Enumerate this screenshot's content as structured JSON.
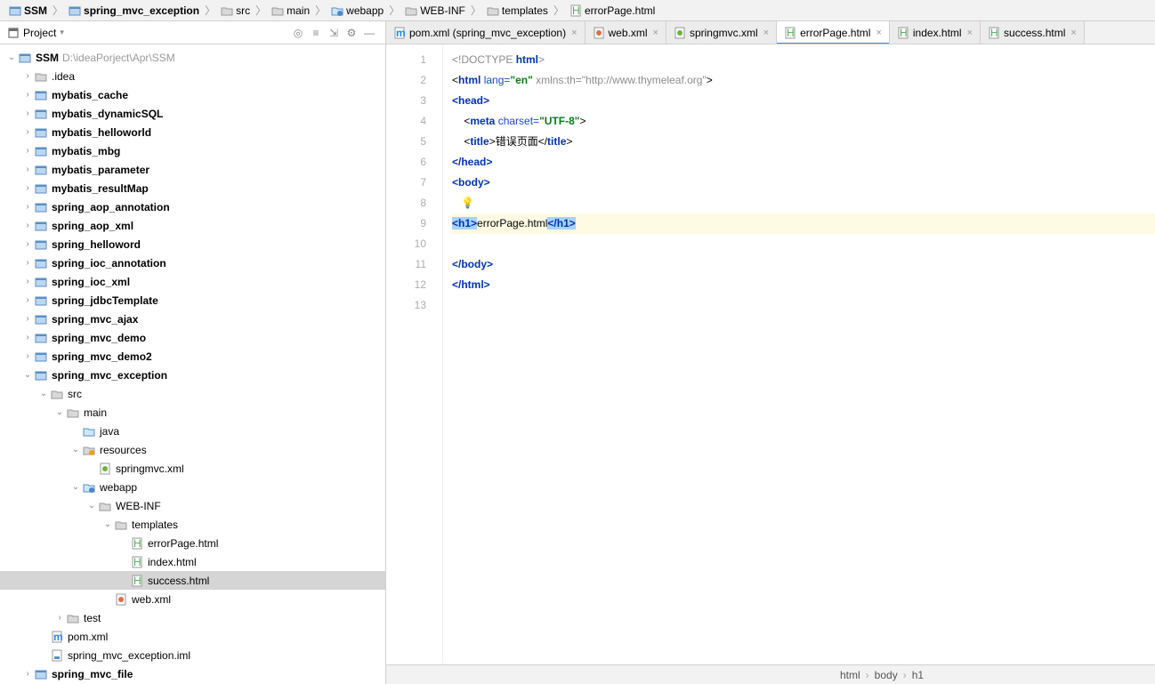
{
  "breadcrumb": [
    {
      "icon": "module",
      "label": "SSM",
      "bold": true
    },
    {
      "icon": "module",
      "label": "spring_mvc_exception",
      "bold": true
    },
    {
      "icon": "folder",
      "label": "src"
    },
    {
      "icon": "folder",
      "label": "main"
    },
    {
      "icon": "folder-web",
      "label": "webapp"
    },
    {
      "icon": "folder",
      "label": "WEB-INF"
    },
    {
      "icon": "folder",
      "label": "templates"
    },
    {
      "icon": "html",
      "label": "errorPage.html"
    }
  ],
  "sidebar": {
    "title": "Project",
    "tools": [
      "target-icon",
      "expand-icon",
      "collapse-icon",
      "gear-icon",
      "hide-icon"
    ]
  },
  "tree": [
    {
      "depth": 0,
      "arrow": "down",
      "icon": "module",
      "label": "SSM",
      "bold": true,
      "extra": "D:\\ideaPorject\\Apr\\SSM"
    },
    {
      "depth": 1,
      "arrow": "right",
      "icon": "folder",
      "label": ".idea"
    },
    {
      "depth": 1,
      "arrow": "right",
      "icon": "module",
      "label": "mybatis_cache",
      "bold": true
    },
    {
      "depth": 1,
      "arrow": "right",
      "icon": "module",
      "label": "mybatis_dynamicSQL",
      "bold": true
    },
    {
      "depth": 1,
      "arrow": "right",
      "icon": "module",
      "label": "mybatis_helloworld",
      "bold": true
    },
    {
      "depth": 1,
      "arrow": "right",
      "icon": "module",
      "label": "mybatis_mbg",
      "bold": true
    },
    {
      "depth": 1,
      "arrow": "right",
      "icon": "module",
      "label": "mybatis_parameter",
      "bold": true
    },
    {
      "depth": 1,
      "arrow": "right",
      "icon": "module",
      "label": "mybatis_resultMap",
      "bold": true
    },
    {
      "depth": 1,
      "arrow": "right",
      "icon": "module",
      "label": "spring_aop_annotation",
      "bold": true
    },
    {
      "depth": 1,
      "arrow": "right",
      "icon": "module",
      "label": "spring_aop_xml",
      "bold": true
    },
    {
      "depth": 1,
      "arrow": "right",
      "icon": "module",
      "label": "spring_helloword",
      "bold": true
    },
    {
      "depth": 1,
      "arrow": "right",
      "icon": "module",
      "label": "spring_ioc_annotation",
      "bold": true
    },
    {
      "depth": 1,
      "arrow": "right",
      "icon": "module",
      "label": "spring_ioc_xml",
      "bold": true
    },
    {
      "depth": 1,
      "arrow": "right",
      "icon": "module",
      "label": "spring_jdbcTemplate",
      "bold": true
    },
    {
      "depth": 1,
      "arrow": "right",
      "icon": "module",
      "label": "spring_mvc_ajax",
      "bold": true
    },
    {
      "depth": 1,
      "arrow": "right",
      "icon": "module",
      "label": "spring_mvc_demo",
      "bold": true
    },
    {
      "depth": 1,
      "arrow": "right",
      "icon": "module",
      "label": "spring_mvc_demo2",
      "bold": true
    },
    {
      "depth": 1,
      "arrow": "down",
      "icon": "module",
      "label": "spring_mvc_exception",
      "bold": true
    },
    {
      "depth": 2,
      "arrow": "down",
      "icon": "folder",
      "label": "src"
    },
    {
      "depth": 3,
      "arrow": "down",
      "icon": "folder",
      "label": "main"
    },
    {
      "depth": 4,
      "arrow": "none",
      "icon": "folder-src",
      "label": "java"
    },
    {
      "depth": 4,
      "arrow": "down",
      "icon": "folder-res",
      "label": "resources"
    },
    {
      "depth": 5,
      "arrow": "none",
      "icon": "xml-spring",
      "label": "springmvc.xml"
    },
    {
      "depth": 4,
      "arrow": "down",
      "icon": "folder-web",
      "label": "webapp"
    },
    {
      "depth": 5,
      "arrow": "down",
      "icon": "folder",
      "label": "WEB-INF"
    },
    {
      "depth": 6,
      "arrow": "down",
      "icon": "folder",
      "label": "templates"
    },
    {
      "depth": 7,
      "arrow": "none",
      "icon": "html",
      "label": "errorPage.html"
    },
    {
      "depth": 7,
      "arrow": "none",
      "icon": "html",
      "label": "index.html"
    },
    {
      "depth": 7,
      "arrow": "none",
      "icon": "html",
      "label": "success.html",
      "selected": true
    },
    {
      "depth": 6,
      "arrow": "none",
      "icon": "xml-web",
      "label": "web.xml"
    },
    {
      "depth": 3,
      "arrow": "right",
      "icon": "folder",
      "label": "test"
    },
    {
      "depth": 2,
      "arrow": "none",
      "icon": "maven",
      "label": "pom.xml"
    },
    {
      "depth": 2,
      "arrow": "none",
      "icon": "iml",
      "label": "spring_mvc_exception.iml"
    },
    {
      "depth": 1,
      "arrow": "right",
      "icon": "module",
      "label": "spring_mvc_file",
      "bold": true
    }
  ],
  "tabs": [
    {
      "icon": "maven",
      "label": "pom.xml (spring_mvc_exception)"
    },
    {
      "icon": "xml-web",
      "label": "web.xml"
    },
    {
      "icon": "xml-spring",
      "label": "springmvc.xml"
    },
    {
      "icon": "html",
      "label": "errorPage.html",
      "active": true
    },
    {
      "icon": "html",
      "label": "index.html"
    },
    {
      "icon": "html",
      "label": "success.html"
    }
  ],
  "code": {
    "lines": [
      "1",
      "2",
      "3",
      "4",
      "5",
      "6",
      "7",
      "8",
      "9",
      "10",
      "11",
      "12",
      "13"
    ],
    "l1_doctype": "<!DOCTYPE ",
    "l1_kw": "html",
    "l1_end": ">",
    "l2_open": "<",
    "l2_tag": "html ",
    "l2_attr": "lang=",
    "l2_val": "\"en\"",
    "l2_gray": " xmlns:th=\"http://www.thymeleaf.org\"",
    "l2_close": ">",
    "l3": "<head>",
    "l4_pre": "    <",
    "l4_tag": "meta ",
    "l4_attr": "charset=",
    "l4_val": "\"UTF-8\"",
    "l4_end": ">",
    "l5_pre": "    <",
    "l5_tag": "title",
    "l5_mid": ">错误页面</",
    "l5_tag2": "title",
    "l5_end": ">",
    "l6": "</head>",
    "l7": "<body>",
    "l9_open": "<h1>",
    "l9_txt": "errorPage.html",
    "l9_close": "</h1>",
    "l11": "</body>",
    "l12": "</html>"
  },
  "statusbar": [
    "html",
    "body",
    "h1"
  ]
}
